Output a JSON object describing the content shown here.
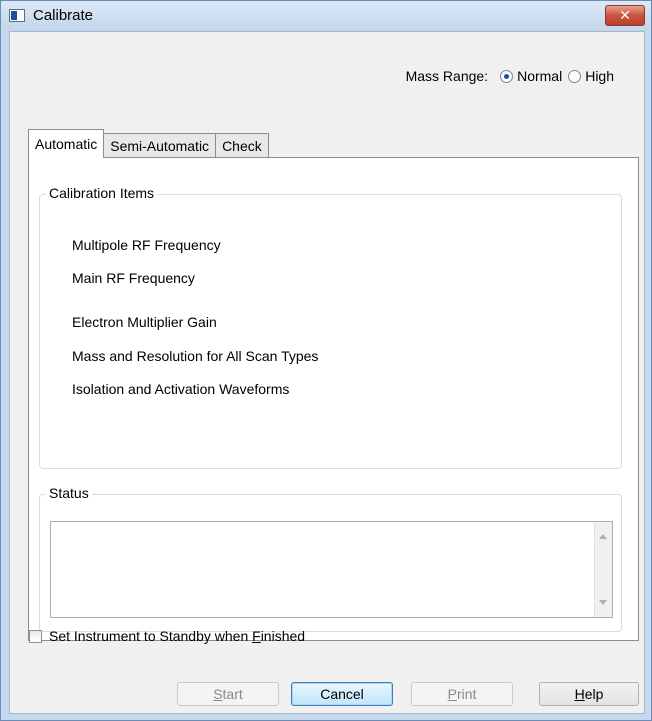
{
  "window": {
    "title": "Calibrate",
    "close_glyph": "✕"
  },
  "mass_range": {
    "label": "Mass Range:",
    "options": [
      {
        "label": "Normal",
        "checked": true
      },
      {
        "label": "High",
        "checked": false
      }
    ]
  },
  "tabs": [
    {
      "label": "Automatic",
      "active": true
    },
    {
      "label": "Semi-Automatic",
      "active": false
    },
    {
      "label": "Check",
      "active": false
    }
  ],
  "calibration": {
    "title": "Calibration Items",
    "items": [
      "Multipole RF Frequency",
      "Main RF Frequency",
      "Electron Multiplier Gain",
      "Mass and Resolution for All Scan Types",
      "Isolation and Activation Waveforms"
    ]
  },
  "status": {
    "title": "Status",
    "text": ""
  },
  "standby": {
    "label_prefix": "Set Instrument to Standby when ",
    "label_accel": "F",
    "label_rest": "inished",
    "checked": false
  },
  "buttons": {
    "start": {
      "accel": "S",
      "rest": "tart",
      "enabled": false
    },
    "cancel": {
      "label": "Cancel",
      "enabled": true
    },
    "print": {
      "accel": "P",
      "rest": "rint",
      "enabled": false
    },
    "help": {
      "accel": "H",
      "rest": "elp",
      "enabled": true
    }
  },
  "colors": {
    "title_bar": "#c5d8ee",
    "close_button": "#c9543f",
    "radio_selected": "#1b4f9c"
  }
}
